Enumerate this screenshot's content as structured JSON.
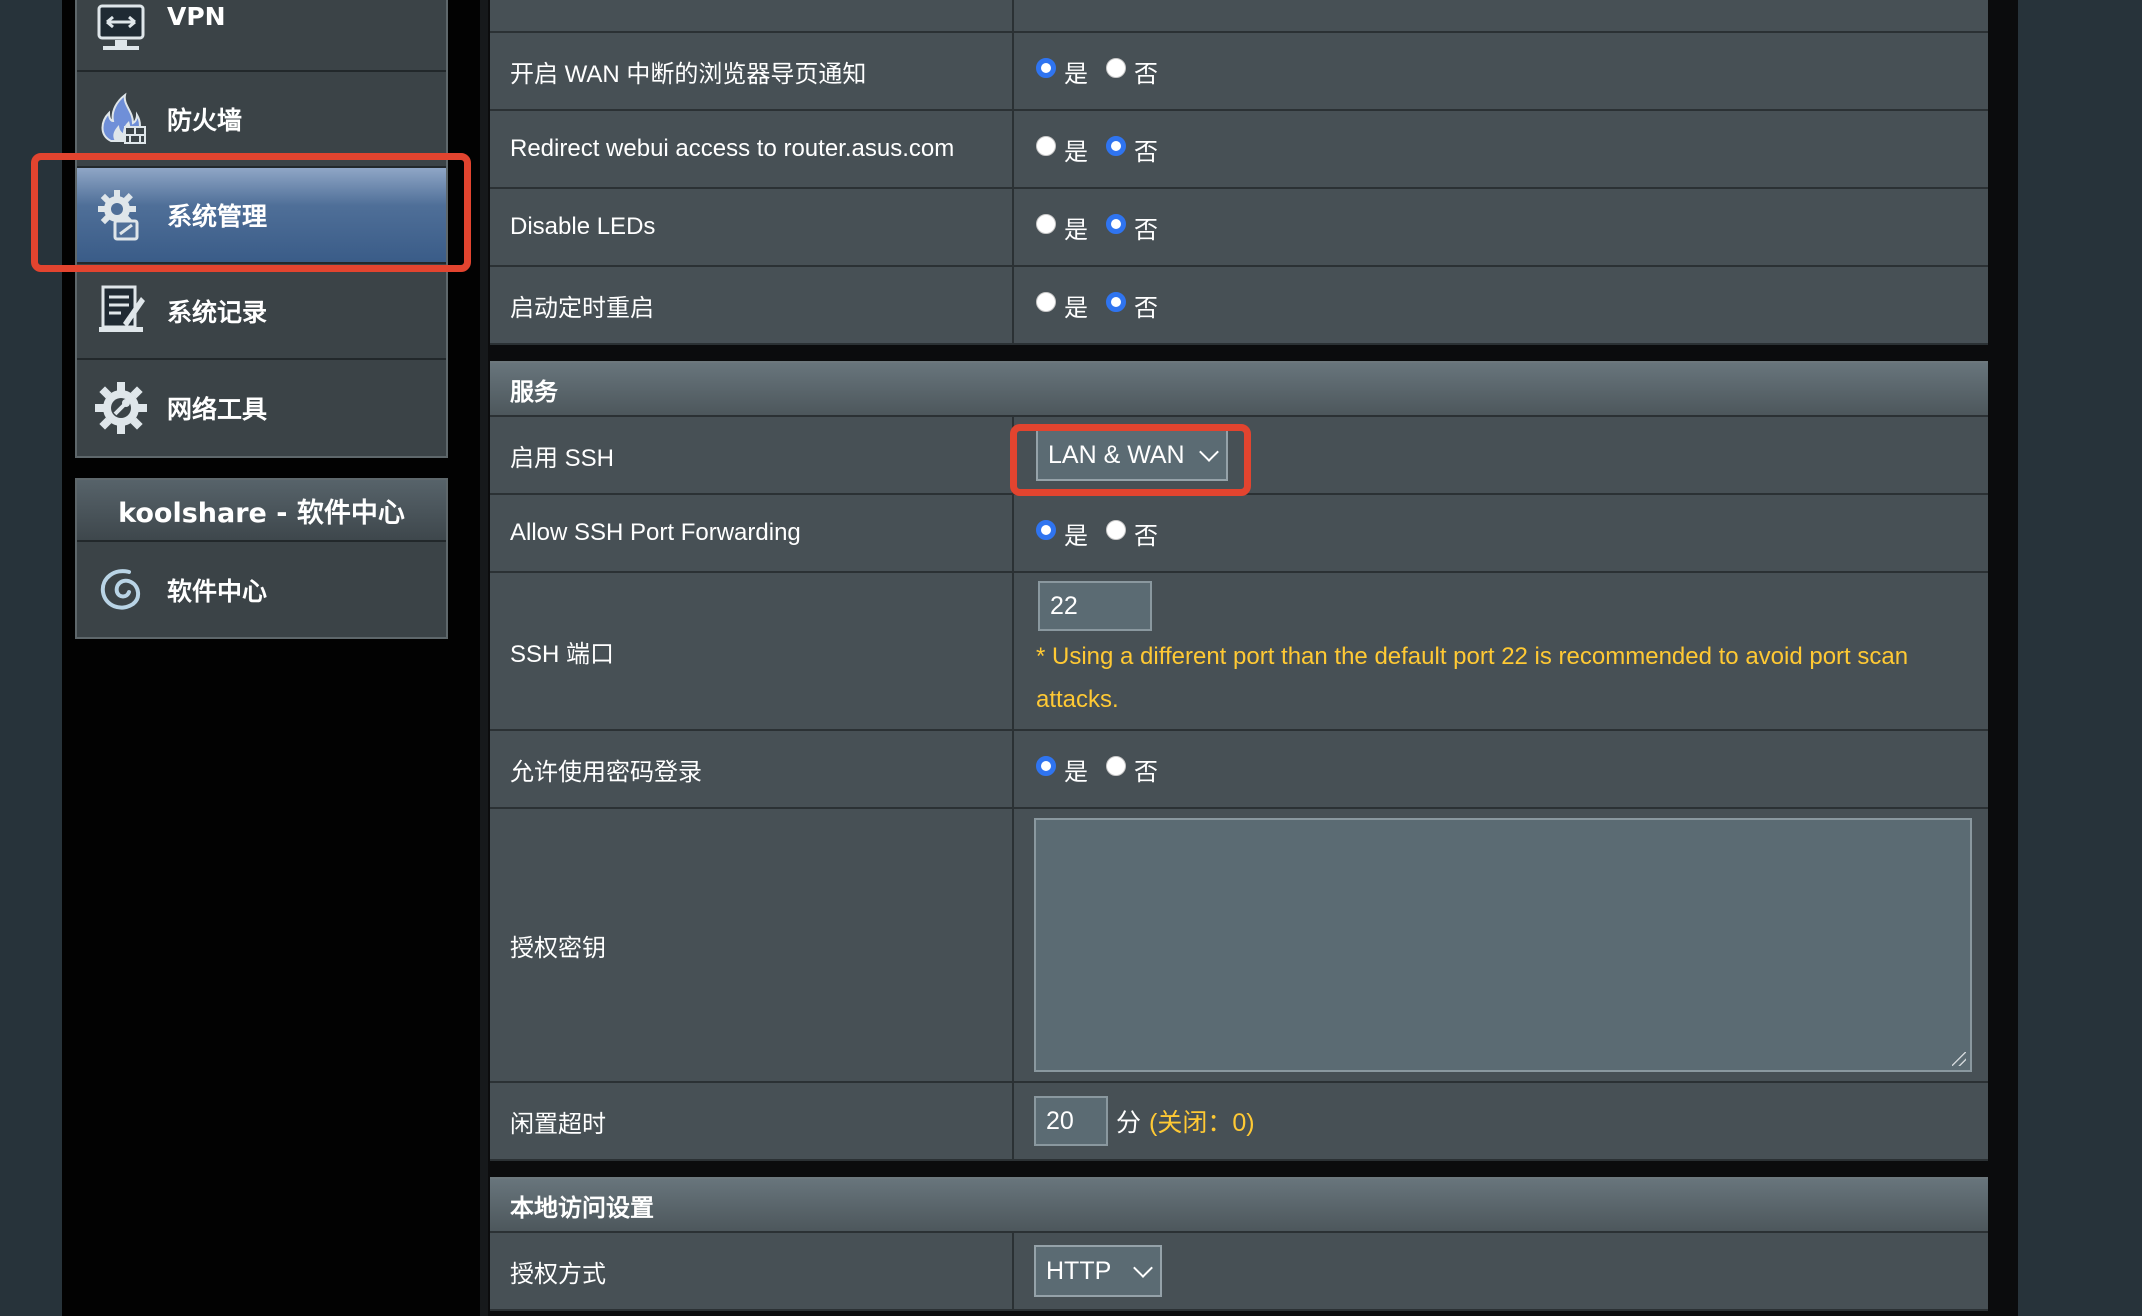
{
  "sidebar": {
    "items": [
      {
        "label": "VPN",
        "icon": "vpn-icon"
      },
      {
        "label": "防火墙",
        "icon": "firewall-icon"
      },
      {
        "label": "系统管理",
        "icon": "administration-gear-icon",
        "active": true
      },
      {
        "label": "系统记录",
        "icon": "system-log-icon"
      },
      {
        "label": "网络工具",
        "icon": "network-tools-gear-icon"
      }
    ],
    "software_panel": {
      "title": "koolshare - 软件中心",
      "item": "软件中心",
      "icon": "software-center-swirl-icon"
    }
  },
  "rows_top": [
    {
      "label": "开启 WAN 中断的浏览器导页通知",
      "yes": "是",
      "no": "否",
      "selected": "yes"
    },
    {
      "label": "Redirect webui access to router.asus.com",
      "yes": "是",
      "no": "否",
      "selected": "no"
    },
    {
      "label": "Disable LEDs",
      "yes": "是",
      "no": "否",
      "selected": "no"
    },
    {
      "label": "启动定时重启",
      "yes": "是",
      "no": "否",
      "selected": "no"
    }
  ],
  "services": {
    "title": "服务",
    "ssh_enable": {
      "label": "启用 SSH",
      "value": "LAN & WAN"
    },
    "ssh_port_forwarding": {
      "label": "Allow SSH Port Forwarding",
      "yes": "是",
      "no": "否",
      "selected": "yes"
    },
    "ssh_port": {
      "label": "SSH 端口",
      "value": "22",
      "note": "* Using a different port than the default port 22 is recommended to avoid port scan attacks."
    },
    "password_login": {
      "label": "允许使用密码登录",
      "yes": "是",
      "no": "否",
      "selected": "yes"
    },
    "authorized_keys": {
      "label": "授权密钥",
      "value": ""
    },
    "idle_timeout": {
      "label": "闲置超时",
      "value": "20",
      "unit": "分",
      "hint": "(关闭：0)"
    }
  },
  "local_access": {
    "title": "本地访问设置",
    "auth_method": {
      "label": "授权方式",
      "value": "HTTP"
    }
  },
  "colors": {
    "highlight": "#e2442f",
    "radio_selected": "#2f74f0",
    "note_text": "#ffc934",
    "active_menu": "#4f6f98"
  }
}
